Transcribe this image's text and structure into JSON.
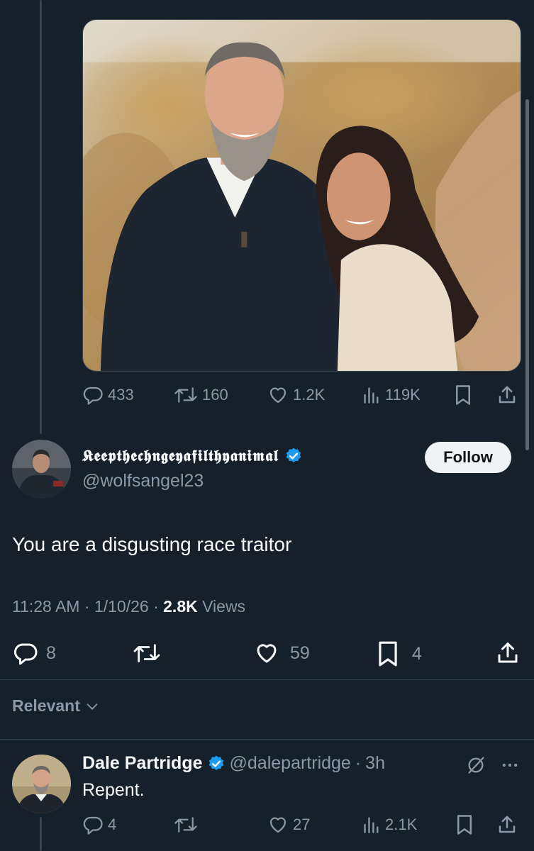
{
  "media_post": {
    "replies": "433",
    "reposts": "160",
    "likes": "1.2K",
    "views": "119K"
  },
  "focused_tweet": {
    "display_name": "𝕶𝖊𝖊𝖕𝖙𝖍𝖊𝖈𝖍𝖓𝖌𝖊𝖞𝖆𝖋𝖎𝖑𝖙𝖍𝖞𝖆𝖓𝖎𝖒𝖆𝖑",
    "handle": "@wolfsangel23",
    "follow_label": "Follow",
    "text": "You are a disgusting race traitor",
    "time": "11:28 AM",
    "sep1": " · ",
    "date": "1/10/26",
    "sep2": " · ",
    "views_count": "2.8K",
    "views_label": " Views",
    "replies": "8",
    "likes": "59",
    "bookmarks": "4"
  },
  "sort": {
    "label": "Relevant"
  },
  "reply": {
    "display_name": "Dale Partridge",
    "handle": "@dalepartridge",
    "sep": "·",
    "time": "3h",
    "text": "Repent.",
    "replies": "4",
    "likes": "27",
    "views": "2.1K"
  },
  "colors": {
    "background": "#15202b",
    "text": "#f7f9f9",
    "muted": "#8b98a5",
    "verified": "#1d9bf0",
    "border": "#38444d"
  }
}
